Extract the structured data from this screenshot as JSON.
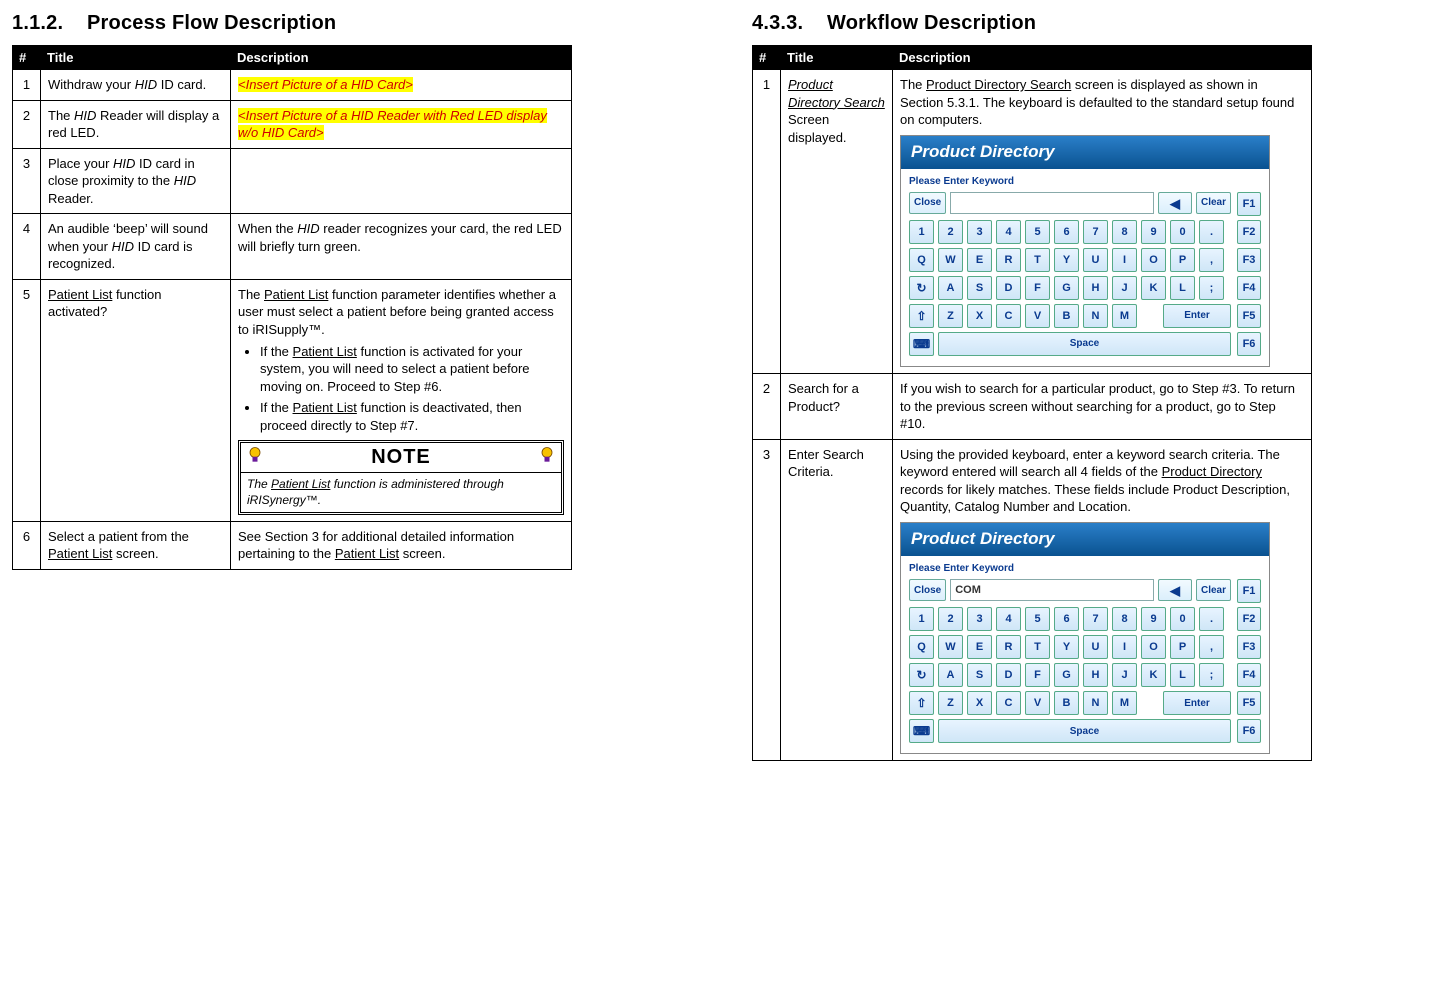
{
  "left": {
    "heading_num": "1.1.2.",
    "heading_text": "Process Flow Description",
    "cols": {
      "num": "#",
      "title": "Title",
      "desc": "Description"
    },
    "rows": [
      {
        "n": "1",
        "title_plain_a": "Withdraw your ",
        "title_ital_a": "HID",
        "title_plain_b": " ID card.",
        "desc_hl": "<Insert Picture of a HID Card>"
      },
      {
        "n": "2",
        "title_plain_a": "The ",
        "title_ital_a": "HID",
        "title_plain_b": " Reader will display a red LED.",
        "desc_hl": "<Insert Picture of a HID Reader with Red LED display w/o HID Card>"
      },
      {
        "n": "3",
        "title_plain_a": "Place your ",
        "title_ital_a": "HID",
        "title_plain_b": " ID card in close proximity to the ",
        "title_ital_b": "HID",
        "title_plain_c": " Reader.",
        "desc": ""
      },
      {
        "n": "4",
        "title_plain_a": "An audible ‘beep’ will sound when your ",
        "title_ital_a": "HID",
        "title_plain_b": " ID card is recognized.",
        "desc_a": "When the ",
        "desc_ital_a": "HID",
        "desc_b": " reader recognizes your card, the red LED will briefly turn green."
      },
      {
        "n": "5",
        "title_ul_a": "Patient List",
        "title_plain_b": " function activated?",
        "desc_a": "The ",
        "desc_ul_a": "Patient List",
        "desc_b": " function parameter identifies whether a user must select a patient before being granted access to iRISupply™.",
        "b1_a": "If the ",
        "b1_ul": "Patient List",
        "b1_b": " function is activated for your system, you will need to select a patient before moving on.  Proceed to Step #6.",
        "b2_a": "If the ",
        "b2_ul": "Patient List",
        "b2_b": " function is deactivated, then proceed directly to Step #7.",
        "note_head": "NOTE",
        "note_a": "The ",
        "note_ul": "Patient List",
        "note_b": " function is administered through iRISynergy™."
      },
      {
        "n": "6",
        "title_plain_a": "Select a patient from the ",
        "title_ul_a": "Patient List",
        "title_plain_b": " screen.",
        "desc_a": "See Section 3 for additional detailed information pertaining to the ",
        "desc_ul_a": "Patient List",
        "desc_b": " screen."
      }
    ]
  },
  "right": {
    "heading_num": "4.3.3.",
    "heading_text": "Workflow Description",
    "cols": {
      "num": "#",
      "title": "Title",
      "desc": "Description"
    },
    "rows": [
      {
        "n": "1",
        "title_ul": "Product Directory Search",
        "title_plain": " Screen displayed.",
        "desc_a": "The ",
        "desc_ul": "Product Directory Search",
        "desc_b": " screen is displayed as shown in Section 5.3.1.  The keyboard is defaulted to the standard setup found on computers."
      },
      {
        "n": "2",
        "title": "Search for a Product?",
        "desc": "If you wish to search for a particular product, go to Step #3.  To return to the previous screen without searching for a product, go to Step #10."
      },
      {
        "n": "3",
        "title": "Enter Search Criteria.",
        "desc_a": "Using the provided keyboard, enter a keyword search criteria.  The keyword entered will search all 4 fields of the ",
        "desc_ul": "Product Directory",
        "desc_b": " records for likely matches.  These fields include Product Description, Quantity, Catalog Number and Location."
      }
    ]
  },
  "pd": {
    "title": "Product Directory",
    "prompt": "Please Enter Keyword",
    "close": "Close",
    "clear": "Clear",
    "enter": "Enter",
    "space": "Space",
    "input_com": "COM",
    "row1": [
      "1",
      "2",
      "3",
      "4",
      "5",
      "6",
      "7",
      "8",
      "9",
      "0",
      "."
    ],
    "row2": [
      "Q",
      "W",
      "E",
      "R",
      "T",
      "Y",
      "U",
      "I",
      "O",
      "P",
      ","
    ],
    "row3": [
      "A",
      "S",
      "D",
      "F",
      "G",
      "H",
      "J",
      "K",
      "L",
      ";"
    ],
    "row4": [
      "Z",
      "X",
      "C",
      "V",
      "B",
      "N",
      "M"
    ],
    "fkeys": [
      "F1",
      "F2",
      "F3",
      "F4",
      "F5",
      "F6"
    ]
  }
}
